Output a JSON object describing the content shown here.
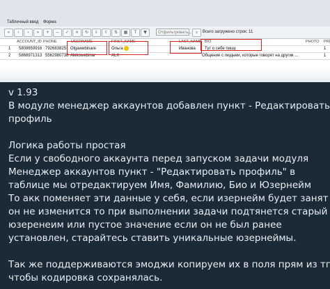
{
  "screenshot": {
    "tabs": [
      "Табличный ввод",
      "Форма"
    ],
    "toolbar": {
      "filter_placeholder": "Отфильтровать...",
      "total_label": "Всего загружено строк: 11"
    },
    "columns": [
      "ACCOUNT_ID",
      "PHONE",
      "USERNAME",
      "FIRST_NAME",
      "LAST_NAME",
      "BIO",
      "PHOTO",
      "PREM"
    ],
    "rows": [
      {
        "num": "1",
        "account_id": "5808659916",
        "phone": "79268382541",
        "username": "Olgawebinare",
        "first_name": "Ольга",
        "last_name": "Иванова",
        "bio": "Тут о себе пишу",
        "photo": "",
        "prem": "1"
      },
      {
        "num": "2",
        "account_id": "5868971313",
        "phone": "5562980738930",
        "username": "Alekowebinar",
        "first_name": "ALX",
        "last_name": "",
        "bio": "Общение с людьми, которые говорят на другик ...",
        "photo": "",
        "prem": "1"
      }
    ],
    "emoji_name": "smiling-face-emoji"
  },
  "message": {
    "lines": [
      "v 1.93",
      "В модуле менеджер аккаунтов добавлен пункт - Редактировать",
      "профиль",
      "",
      "Логика работы простая",
      "Если у свободного аккаунта перед запуском задачи модуля",
      "Менеджер аккаунтов пункт - \"Редактировать профиль\"  в",
      "таблице мы отредактируем  Имя, Фамилию, Био и Юзернейм",
      "То акк поменяет эти данные у себя, если изернейм будет занят",
      "он не изменится то при выполнении задачи подтянется старый",
      "юзеренеим или пустое значение если он не был ранее",
      "установлен, старайтесь ставить уникальные юзернеймы.",
      "",
      "Так же поддерживаются эмоджи копируем их в поля прям из тг",
      "чтобы кодировка сохранялась."
    ]
  },
  "colors": {
    "background": "#1b2a37",
    "text": "#e9eef2",
    "highlight_box": "#e0201b"
  }
}
